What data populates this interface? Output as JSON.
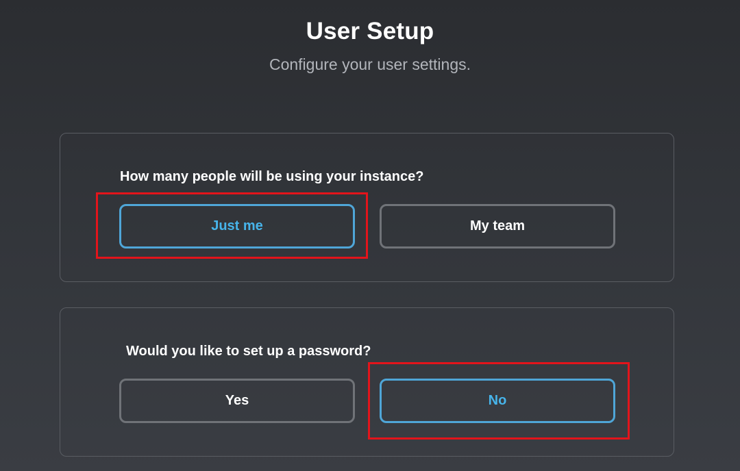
{
  "header": {
    "title": "User Setup",
    "subtitle": "Configure your user settings."
  },
  "users_section": {
    "question": "How many people will be using your instance?",
    "options": [
      {
        "label": "Just me",
        "selected": true
      },
      {
        "label": "My team",
        "selected": false
      }
    ]
  },
  "password_section": {
    "question": "Would you like to set up a password?",
    "options": [
      {
        "label": "Yes",
        "selected": false
      },
      {
        "label": "No",
        "selected": true
      }
    ]
  },
  "colors": {
    "background": "#2b2d31",
    "selected_accent": "#47b4ea",
    "unselected_border": "#707378",
    "highlight": "#e3141b"
  }
}
